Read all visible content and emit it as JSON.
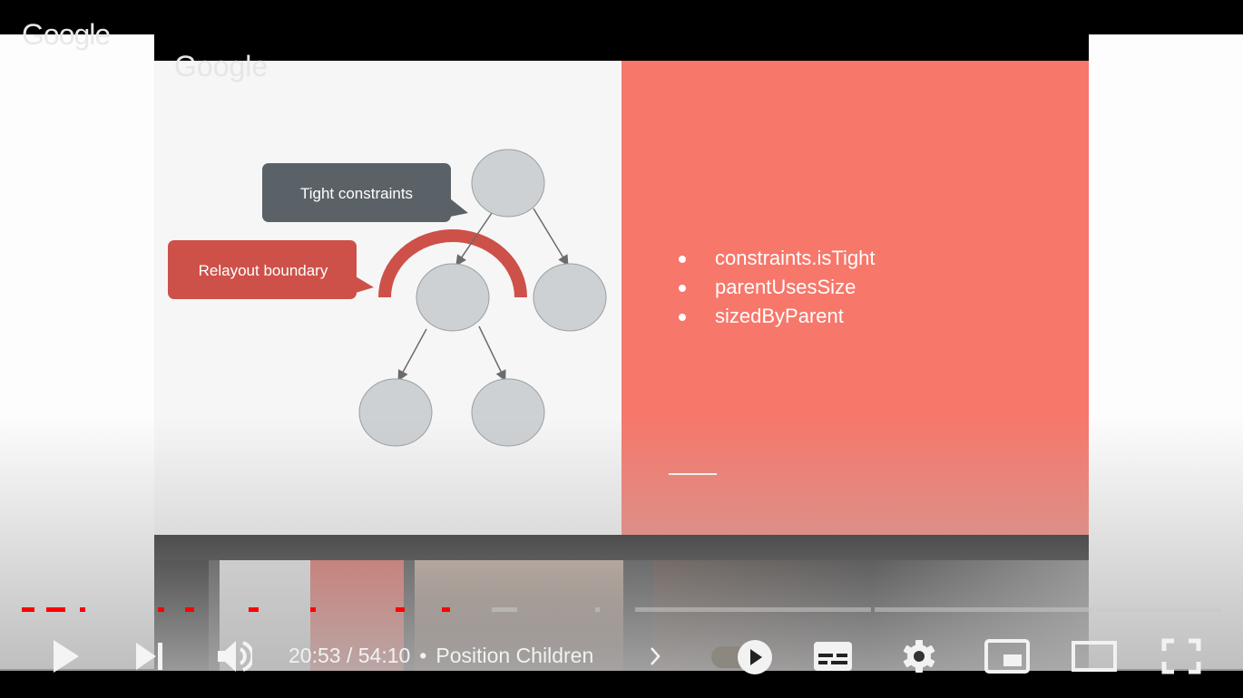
{
  "slide": {
    "logo": "Google",
    "callout_tight": "Tight constraints",
    "callout_relayout": "Relayout boundary",
    "bullets": [
      "constraints.isTight",
      "parentUsesSize",
      "sizedByParent"
    ],
    "colors": {
      "accent": "#f7776b",
      "callout_dark": "#5a6268",
      "callout_red": "#cd5148",
      "node": "#cdd1d4"
    }
  },
  "player": {
    "current_time": "20:53",
    "separator": "/",
    "duration": "54:10",
    "chapter": "Position Children",
    "progress_percent": 38.6,
    "autoplay_on": false,
    "played_color": "#ff0000",
    "icons": [
      "play-icon",
      "next-icon",
      "volume-icon",
      "chevron-right-icon",
      "autoplay-toggle-icon",
      "subtitles-icon",
      "settings-icon",
      "miniplayer-icon",
      "theater-mode-icon",
      "fullscreen-icon"
    ]
  }
}
